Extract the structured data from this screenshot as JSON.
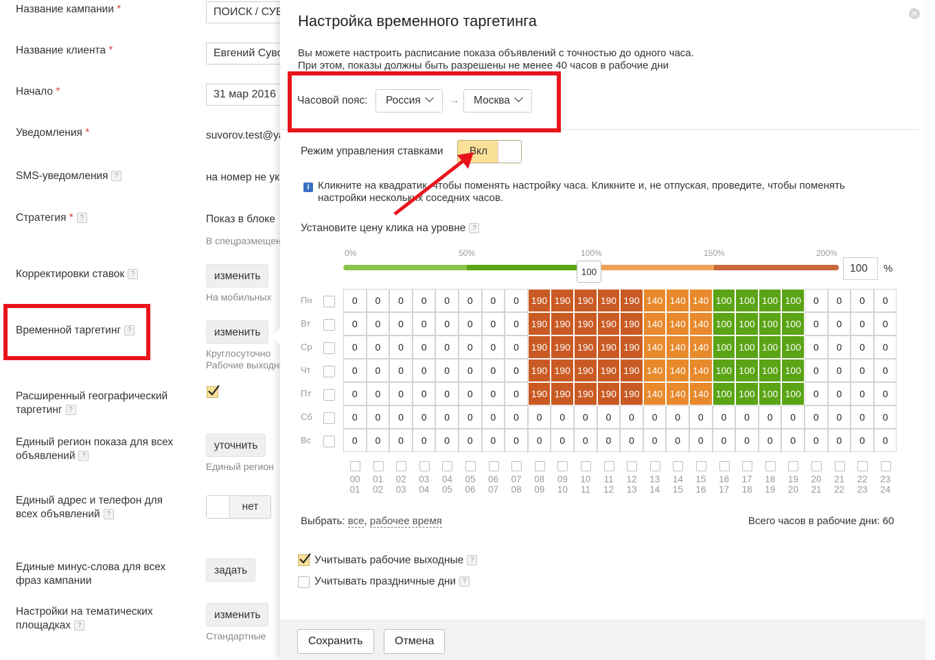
{
  "form": {
    "campaign_name": {
      "label": "Название кампании",
      "value": "ПОИСК / СУВОРОВ"
    },
    "client_name": {
      "label": "Название клиента",
      "value": "Евгений Суворов"
    },
    "start": {
      "label": "Начало",
      "value": "31 мар 2016"
    },
    "notifications": {
      "label": "Уведомления",
      "value": "suvorov.test@yandex.ru"
    },
    "sms": {
      "label": "SMS-уведомления",
      "value": "на номер не указан"
    },
    "strategy": {
      "label": "Стратегия",
      "value": "Показ в блоке",
      "sub": "В спецразмещении"
    },
    "bid_adjust": {
      "label": "Корректировки ставок",
      "button": "изменить",
      "sub": "На мобильных"
    },
    "time_targeting": {
      "label": "Временной таргетинг",
      "button": "изменить",
      "sub1": "Круглосуточно",
      "sub2": "Рабочие выходные"
    },
    "geo": {
      "label1": "Расширенный географический",
      "label2": "таргетинг"
    },
    "region": {
      "label1": "Единый регион показа для всех",
      "label2": "объявлений",
      "button": "уточнить",
      "sub": "Единый регион"
    },
    "address": {
      "label1": "Единый адрес и телефон для",
      "label2": "всех объявлений",
      "toggle": "нет"
    },
    "minus": {
      "label1": "Единые минус-слова для всех",
      "label2": "фраз кампании",
      "button": "задать"
    },
    "thematic": {
      "label1": "Настройки на тематических",
      "label2": "площадках",
      "button": "изменить",
      "sub": "Стандартные"
    }
  },
  "modal": {
    "title": "Настройка временного таргетинга",
    "desc1": "Вы можете настроить расписание показа объявлений с точностью до одного часа.",
    "desc2": "При этом, показы должны быть разрешены не менее 40 часов в рабочие дни",
    "tz_label": "Часовой пояс:",
    "tz_country": "Россия",
    "tz_arrow": "→",
    "tz_city": "Москва",
    "bid_mode_label": "Режим управления ставками",
    "bid_mode_value": "Вкл",
    "hint1": "Кликните на квадратик, чтобы поменять настройку часа. Кликните и, не отпуская, проведите, чтобы поменять",
    "hint2": "настройки нескольких соседних часов.",
    "price_label": "Установите цену клика на уровне",
    "scale": [
      "0%",
      "50%",
      "100%",
      "150%",
      "200%"
    ],
    "slider_value": "100",
    "price_input": "100",
    "percent": "%",
    "days": [
      "Пн",
      "Вт",
      "Ср",
      "Чт",
      "Пт",
      "Сб",
      "Вс"
    ],
    "schedule": [
      [
        0,
        0,
        0,
        0,
        0,
        0,
        0,
        0,
        190,
        190,
        190,
        190,
        190,
        140,
        140,
        140,
        100,
        100,
        100,
        100,
        0,
        0,
        0,
        0
      ],
      [
        0,
        0,
        0,
        0,
        0,
        0,
        0,
        0,
        190,
        190,
        190,
        190,
        190,
        140,
        140,
        140,
        100,
        100,
        100,
        100,
        0,
        0,
        0,
        0
      ],
      [
        0,
        0,
        0,
        0,
        0,
        0,
        0,
        0,
        190,
        190,
        190,
        190,
        190,
        140,
        140,
        140,
        100,
        100,
        100,
        100,
        0,
        0,
        0,
        0
      ],
      [
        0,
        0,
        0,
        0,
        0,
        0,
        0,
        0,
        190,
        190,
        190,
        190,
        190,
        140,
        140,
        140,
        100,
        100,
        100,
        100,
        0,
        0,
        0,
        0
      ],
      [
        0,
        0,
        0,
        0,
        0,
        0,
        0,
        0,
        190,
        190,
        190,
        190,
        190,
        140,
        140,
        140,
        100,
        100,
        100,
        100,
        0,
        0,
        0,
        0
      ],
      [
        0,
        0,
        0,
        0,
        0,
        0,
        0,
        0,
        0,
        0,
        0,
        0,
        0,
        0,
        0,
        0,
        0,
        0,
        0,
        0,
        0,
        0,
        0,
        0
      ],
      [
        0,
        0,
        0,
        0,
        0,
        0,
        0,
        0,
        0,
        0,
        0,
        0,
        0,
        0,
        0,
        0,
        0,
        0,
        0,
        0,
        0,
        0,
        0,
        0
      ]
    ],
    "hours_top": [
      "00",
      "01",
      "02",
      "03",
      "04",
      "05",
      "06",
      "07",
      "08",
      "09",
      "10",
      "11",
      "12",
      "13",
      "14",
      "15",
      "16",
      "17",
      "18",
      "19",
      "20",
      "21",
      "22",
      "23"
    ],
    "hours_bottom": [
      "01",
      "02",
      "03",
      "04",
      "05",
      "06",
      "07",
      "08",
      "09",
      "10",
      "11",
      "12",
      "13",
      "14",
      "15",
      "16",
      "17",
      "18",
      "19",
      "20",
      "21",
      "22",
      "23",
      "24"
    ],
    "select_label": "Выбрать:",
    "select_all": "все",
    "select_work": "рабочее время",
    "total_hours": "Всего часов в рабочие дни: 60",
    "chk_workdays": "Учитывать рабочие выходные",
    "chk_holidays": "Учитывать праздничные дни",
    "save": "Сохранить",
    "cancel": "Отмена"
  },
  "colors": {
    "accent_red": "#e8141c",
    "bid190": "#c95a23",
    "bid140": "#e8892c",
    "bid100": "#5aa415",
    "toggle_on": "#fbe197"
  }
}
